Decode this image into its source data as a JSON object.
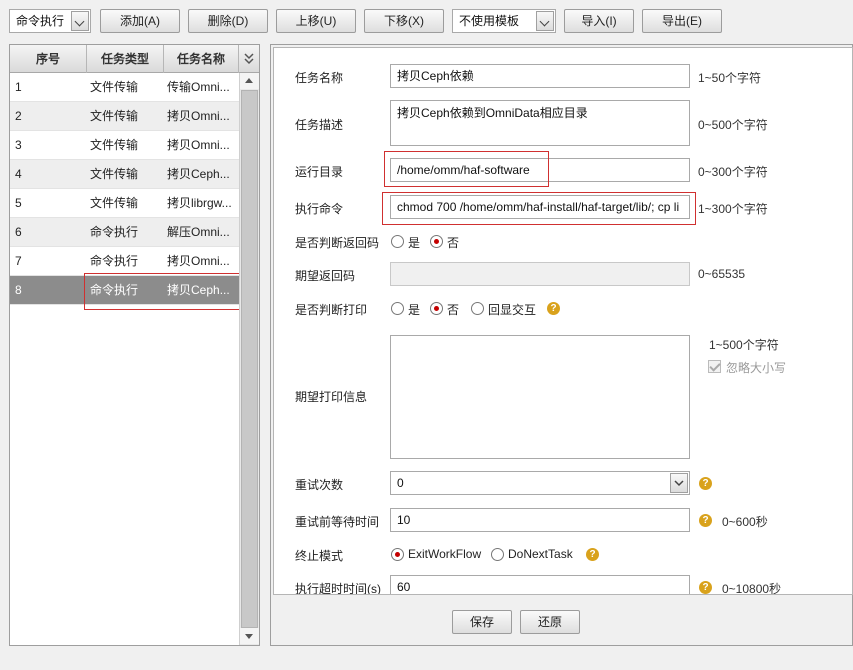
{
  "toolbar": {
    "task_type_select": "命令执行",
    "add": "添加(A)",
    "delete": "删除(D)",
    "move_up": "上移(U)",
    "move_down": "下移(X)",
    "template_select": "不使用模板",
    "import": "导入(I)",
    "export": "导出(E)"
  },
  "grid": {
    "columns": [
      "序号",
      "任务类型",
      "任务名称"
    ],
    "rows": [
      {
        "no": "1",
        "type": "文件传输",
        "name": "传输Omni..."
      },
      {
        "no": "2",
        "type": "文件传输",
        "name": "拷贝Omni..."
      },
      {
        "no": "3",
        "type": "文件传输",
        "name": "拷贝Omni..."
      },
      {
        "no": "4",
        "type": "文件传输",
        "name": "拷贝Ceph..."
      },
      {
        "no": "5",
        "type": "文件传输",
        "name": "拷贝librgw..."
      },
      {
        "no": "6",
        "type": "命令执行",
        "name": "解压Omni..."
      },
      {
        "no": "7",
        "type": "命令执行",
        "name": "拷贝Omni..."
      },
      {
        "no": "8",
        "type": "命令执行",
        "name": "拷贝Ceph..."
      }
    ],
    "selected_row": 8
  },
  "form": {
    "task_name": {
      "label": "任务名称",
      "value": "拷贝Ceph依赖",
      "hint": "1~50个字符"
    },
    "task_desc": {
      "label": "任务描述",
      "value": "拷贝Ceph依赖到OmniData相应目录",
      "hint": "0~500个字符"
    },
    "run_dir": {
      "label": "运行目录",
      "value": "/home/omm/haf-software",
      "hint": "0~300个字符"
    },
    "exec_cmd": {
      "label": "执行命令",
      "value": "chmod 700 /home/omm/haf-install/haf-target/lib/; cp li",
      "hint": "1~300个字符"
    },
    "judge_return": {
      "label": "是否判断返回码",
      "yes": "是",
      "no": "否",
      "selected": "否"
    },
    "expected_return": {
      "label": "期望返回码",
      "value": "",
      "hint": "0~65535"
    },
    "judge_print": {
      "label": "是否判断打印",
      "yes": "是",
      "no": "否",
      "echo": "回显交互",
      "selected": "否"
    },
    "expected_print": {
      "label": "期望打印信息",
      "value": "",
      "hint": "1~500个字符",
      "ignore_case": "忽略大小写"
    },
    "retry_count": {
      "label": "重试次数",
      "value": "0"
    },
    "retry_wait": {
      "label": "重试前等待时间",
      "value": "10",
      "hint": "0~600秒"
    },
    "stop_mode": {
      "label": "终止模式",
      "opt1": "ExitWorkFlow",
      "opt2": "DoNextTask",
      "selected": "ExitWorkFlow"
    },
    "timeout": {
      "label": "执行超时时间(s)",
      "value": "60",
      "hint": "0~10800秒"
    }
  },
  "footer": {
    "save": "保存",
    "restore": "还原"
  },
  "colors": {
    "highlight_border": "#d03030",
    "radio_selected": "#c40000",
    "help_icon": "#d9a21c",
    "selected_row": "#8c8c8c"
  }
}
